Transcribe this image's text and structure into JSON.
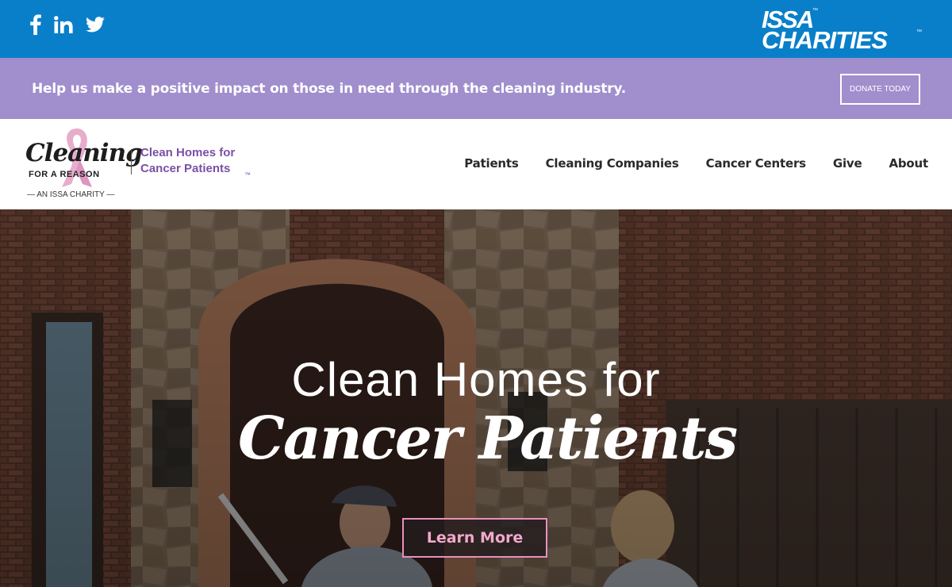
{
  "topbar": {
    "social": [
      {
        "name": "facebook-icon",
        "glyph": "f"
      },
      {
        "name": "linkedin-icon",
        "glyph": "in"
      },
      {
        "name": "twitter-icon",
        "glyph": "twitter"
      }
    ],
    "issa_logo": {
      "line1": "ISSA",
      "line2": "CHARITIES",
      "tm": "™"
    }
  },
  "promo": {
    "text": "Help us make a positive impact on those in need through the cleaning industry.",
    "donate_label": "DONATE TODAY"
  },
  "header": {
    "logo": {
      "script": "Cleaning",
      "reason": "FOR A REASON",
      "tagline_1": "Clean Homes for",
      "tagline_2": "Cancer Patients",
      "tm": "™",
      "charity": "— AN ISSA CHARITY —"
    },
    "nav": [
      "Patients",
      "Cleaning Companies",
      "Cancer Centers",
      "Give",
      "About"
    ]
  },
  "hero": {
    "line1": "Clean Homes for",
    "line2": "Cancer Patients",
    "tm": "™",
    "cta_label": "Learn More"
  },
  "colors": {
    "topbar": "#0a7fc9",
    "promo": "#a08ecd",
    "tagline": "#7b4fa5",
    "cta_border": "#e790bd"
  }
}
